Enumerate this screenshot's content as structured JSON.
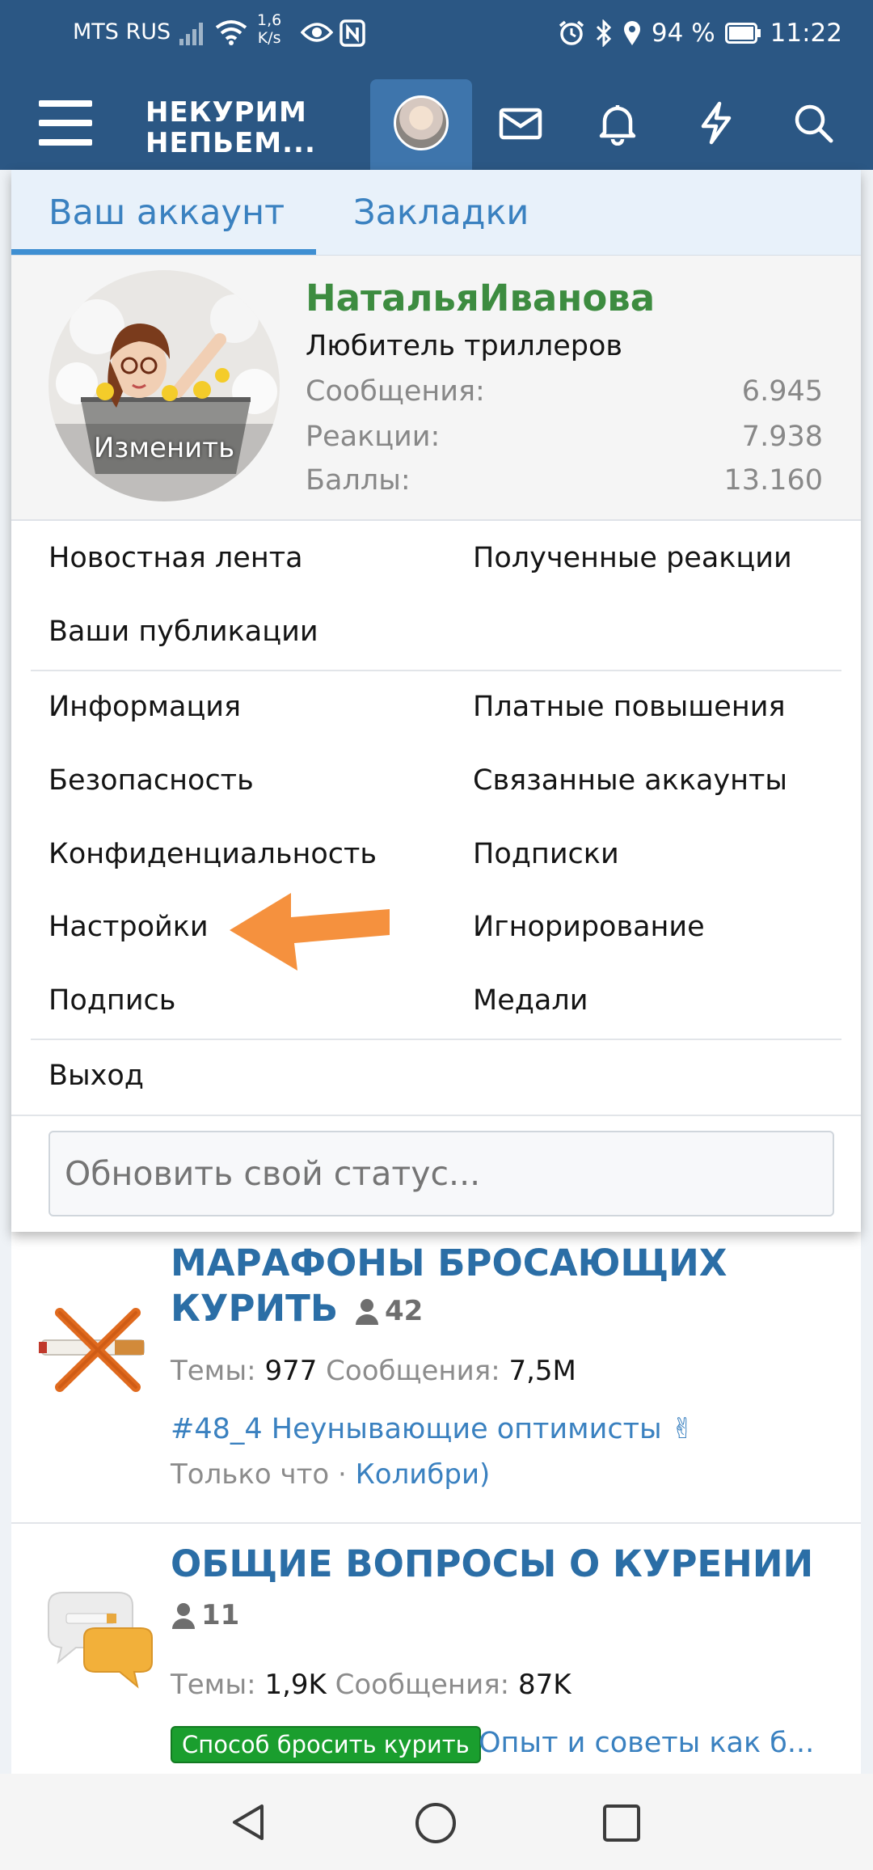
{
  "status_bar": {
    "carrier": "MTS RUS",
    "speed_value": "1,6",
    "speed_unit": "K/s",
    "battery": "94 %",
    "time": "11:22"
  },
  "header": {
    "logo_line1": "НЕКУРИМ",
    "logo_line2": "НЕПЬЕМ..."
  },
  "menu": {
    "tabs": [
      "Ваш аккаунт",
      "Закладки"
    ],
    "profile": {
      "username": "НатальяИванова",
      "user_title": "Любитель триллеров",
      "avatar_edit": "Изменить",
      "stats": [
        {
          "label": "Сообщения:",
          "value": "6.945"
        },
        {
          "label": "Реакции:",
          "value": "7.938"
        },
        {
          "label": "Баллы:",
          "value": "13.160"
        }
      ]
    },
    "links_group1": {
      "left": [
        "Новостная лента",
        "Ваши публикации"
      ],
      "right": [
        "Полученные реакции"
      ]
    },
    "links_group2": {
      "left": [
        "Информация",
        "Безопасность",
        "Конфиденциальность",
        "Настройки",
        "Подпись"
      ],
      "right": [
        "Платные повышения",
        "Связанные аккаунты",
        "Подписки",
        "Игнорирование",
        "Медали"
      ]
    },
    "logout": "Выход",
    "status_placeholder": "Обновить свой статус..."
  },
  "forums": [
    {
      "title_line1": "МАРАФОНЫ БРОСАЮЩИХ",
      "title_line2": "КУРИТЬ",
      "viewers": "42",
      "threads_label": "Темы:",
      "threads": "977",
      "posts_label": "Сообщения:",
      "posts": "7,5M",
      "last_thread": "#48_4 Неунывающие оптимисты ✌",
      "last_time": "Только что",
      "last_user": "Колибри)"
    },
    {
      "title_line1": "ОБЩИЕ ВОПРОСЫ О КУРЕНИИ",
      "viewers": "11",
      "threads_label": "Темы:",
      "threads": "1,9K",
      "posts_label": "Сообщения:",
      "posts": "87K",
      "prefix": "Способ бросить курить",
      "last_thread": "Опыт и советы как б..."
    }
  ],
  "colors": {
    "header_blue": "#2b5784",
    "link_blue": "#3a81c0",
    "username_green": "#3d8c40",
    "arrow_orange": "#f5913e"
  }
}
